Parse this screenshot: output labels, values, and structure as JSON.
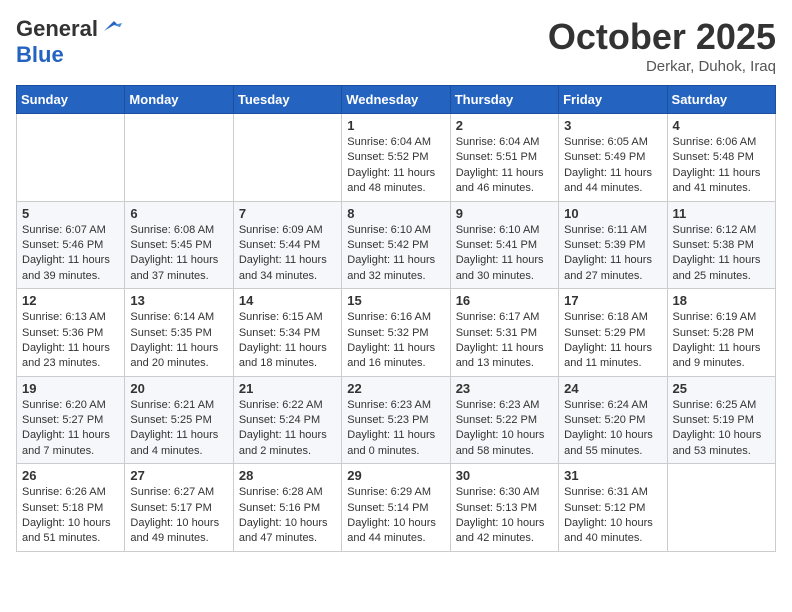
{
  "header": {
    "logo_general": "General",
    "logo_blue": "Blue",
    "month": "October 2025",
    "location": "Derkar, Duhok, Iraq"
  },
  "weekdays": [
    "Sunday",
    "Monday",
    "Tuesday",
    "Wednesday",
    "Thursday",
    "Friday",
    "Saturday"
  ],
  "weeks": [
    [
      {
        "day": "",
        "info": ""
      },
      {
        "day": "",
        "info": ""
      },
      {
        "day": "",
        "info": ""
      },
      {
        "day": "1",
        "info": "Sunrise: 6:04 AM\nSunset: 5:52 PM\nDaylight: 11 hours and 48 minutes."
      },
      {
        "day": "2",
        "info": "Sunrise: 6:04 AM\nSunset: 5:51 PM\nDaylight: 11 hours and 46 minutes."
      },
      {
        "day": "3",
        "info": "Sunrise: 6:05 AM\nSunset: 5:49 PM\nDaylight: 11 hours and 44 minutes."
      },
      {
        "day": "4",
        "info": "Sunrise: 6:06 AM\nSunset: 5:48 PM\nDaylight: 11 hours and 41 minutes."
      }
    ],
    [
      {
        "day": "5",
        "info": "Sunrise: 6:07 AM\nSunset: 5:46 PM\nDaylight: 11 hours and 39 minutes."
      },
      {
        "day": "6",
        "info": "Sunrise: 6:08 AM\nSunset: 5:45 PM\nDaylight: 11 hours and 37 minutes."
      },
      {
        "day": "7",
        "info": "Sunrise: 6:09 AM\nSunset: 5:44 PM\nDaylight: 11 hours and 34 minutes."
      },
      {
        "day": "8",
        "info": "Sunrise: 6:10 AM\nSunset: 5:42 PM\nDaylight: 11 hours and 32 minutes."
      },
      {
        "day": "9",
        "info": "Sunrise: 6:10 AM\nSunset: 5:41 PM\nDaylight: 11 hours and 30 minutes."
      },
      {
        "day": "10",
        "info": "Sunrise: 6:11 AM\nSunset: 5:39 PM\nDaylight: 11 hours and 27 minutes."
      },
      {
        "day": "11",
        "info": "Sunrise: 6:12 AM\nSunset: 5:38 PM\nDaylight: 11 hours and 25 minutes."
      }
    ],
    [
      {
        "day": "12",
        "info": "Sunrise: 6:13 AM\nSunset: 5:36 PM\nDaylight: 11 hours and 23 minutes."
      },
      {
        "day": "13",
        "info": "Sunrise: 6:14 AM\nSunset: 5:35 PM\nDaylight: 11 hours and 20 minutes."
      },
      {
        "day": "14",
        "info": "Sunrise: 6:15 AM\nSunset: 5:34 PM\nDaylight: 11 hours and 18 minutes."
      },
      {
        "day": "15",
        "info": "Sunrise: 6:16 AM\nSunset: 5:32 PM\nDaylight: 11 hours and 16 minutes."
      },
      {
        "day": "16",
        "info": "Sunrise: 6:17 AM\nSunset: 5:31 PM\nDaylight: 11 hours and 13 minutes."
      },
      {
        "day": "17",
        "info": "Sunrise: 6:18 AM\nSunset: 5:29 PM\nDaylight: 11 hours and 11 minutes."
      },
      {
        "day": "18",
        "info": "Sunrise: 6:19 AM\nSunset: 5:28 PM\nDaylight: 11 hours and 9 minutes."
      }
    ],
    [
      {
        "day": "19",
        "info": "Sunrise: 6:20 AM\nSunset: 5:27 PM\nDaylight: 11 hours and 7 minutes."
      },
      {
        "day": "20",
        "info": "Sunrise: 6:21 AM\nSunset: 5:25 PM\nDaylight: 11 hours and 4 minutes."
      },
      {
        "day": "21",
        "info": "Sunrise: 6:22 AM\nSunset: 5:24 PM\nDaylight: 11 hours and 2 minutes."
      },
      {
        "day": "22",
        "info": "Sunrise: 6:23 AM\nSunset: 5:23 PM\nDaylight: 11 hours and 0 minutes."
      },
      {
        "day": "23",
        "info": "Sunrise: 6:23 AM\nSunset: 5:22 PM\nDaylight: 10 hours and 58 minutes."
      },
      {
        "day": "24",
        "info": "Sunrise: 6:24 AM\nSunset: 5:20 PM\nDaylight: 10 hours and 55 minutes."
      },
      {
        "day": "25",
        "info": "Sunrise: 6:25 AM\nSunset: 5:19 PM\nDaylight: 10 hours and 53 minutes."
      }
    ],
    [
      {
        "day": "26",
        "info": "Sunrise: 6:26 AM\nSunset: 5:18 PM\nDaylight: 10 hours and 51 minutes."
      },
      {
        "day": "27",
        "info": "Sunrise: 6:27 AM\nSunset: 5:17 PM\nDaylight: 10 hours and 49 minutes."
      },
      {
        "day": "28",
        "info": "Sunrise: 6:28 AM\nSunset: 5:16 PM\nDaylight: 10 hours and 47 minutes."
      },
      {
        "day": "29",
        "info": "Sunrise: 6:29 AM\nSunset: 5:14 PM\nDaylight: 10 hours and 44 minutes."
      },
      {
        "day": "30",
        "info": "Sunrise: 6:30 AM\nSunset: 5:13 PM\nDaylight: 10 hours and 42 minutes."
      },
      {
        "day": "31",
        "info": "Sunrise: 6:31 AM\nSunset: 5:12 PM\nDaylight: 10 hours and 40 minutes."
      },
      {
        "day": "",
        "info": ""
      }
    ]
  ]
}
